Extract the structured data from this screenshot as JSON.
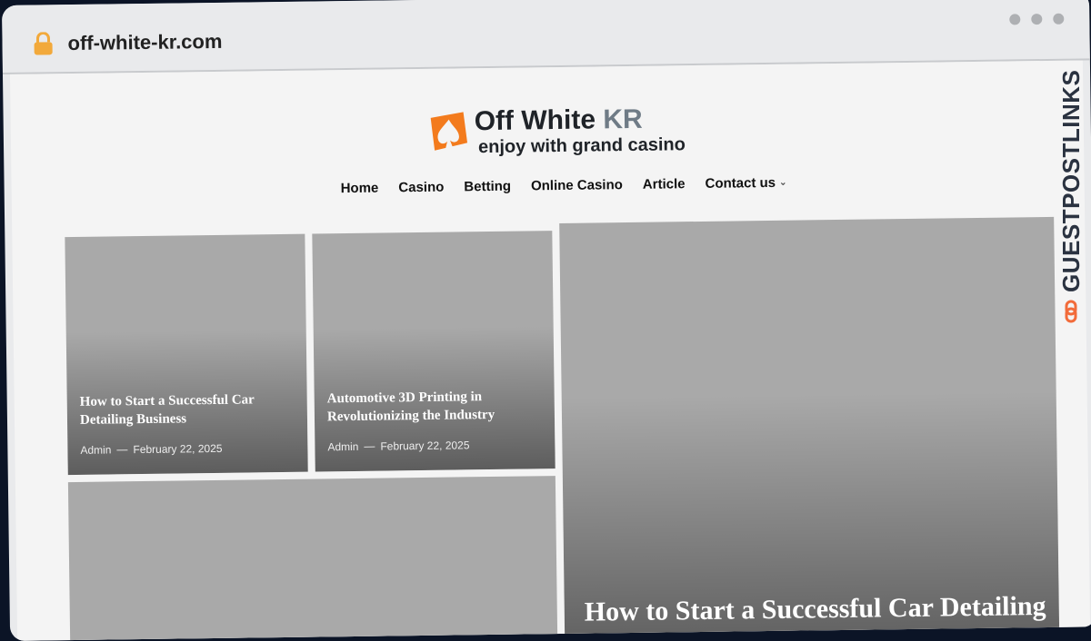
{
  "browser": {
    "url": "off-white-kr.com",
    "lock_icon": "lock-icon"
  },
  "header": {
    "logo_title": "Off White",
    "logo_title_accent": "KR",
    "logo_tagline": "enjoy with grand casino",
    "logo_icon": "spade-icon"
  },
  "nav": {
    "items": [
      "Home",
      "Casino",
      "Betting",
      "Online Casino",
      "Article",
      "Contact us"
    ]
  },
  "posts": [
    {
      "title": "How to Start a Successful Car Detailing Business",
      "author": "Admin",
      "date": "February 22, 2025"
    },
    {
      "title": "Automotive 3D Printing in Revolutionizing the Industry",
      "author": "Admin",
      "date": "February 22, 2025"
    },
    {
      "title": ""
    },
    {
      "title": "How to Start a Successful Car Detailing"
    }
  ],
  "badge": {
    "text": "GUESTPOSTLINKS",
    "icon": "link-icon",
    "accent": "#f26b3a"
  },
  "colors": {
    "background": "#0b1426",
    "browser_chrome": "#e9eaec",
    "page": "#f4f4f4",
    "card": "#a9a9a9",
    "logo_orange": "#f37b1d"
  }
}
